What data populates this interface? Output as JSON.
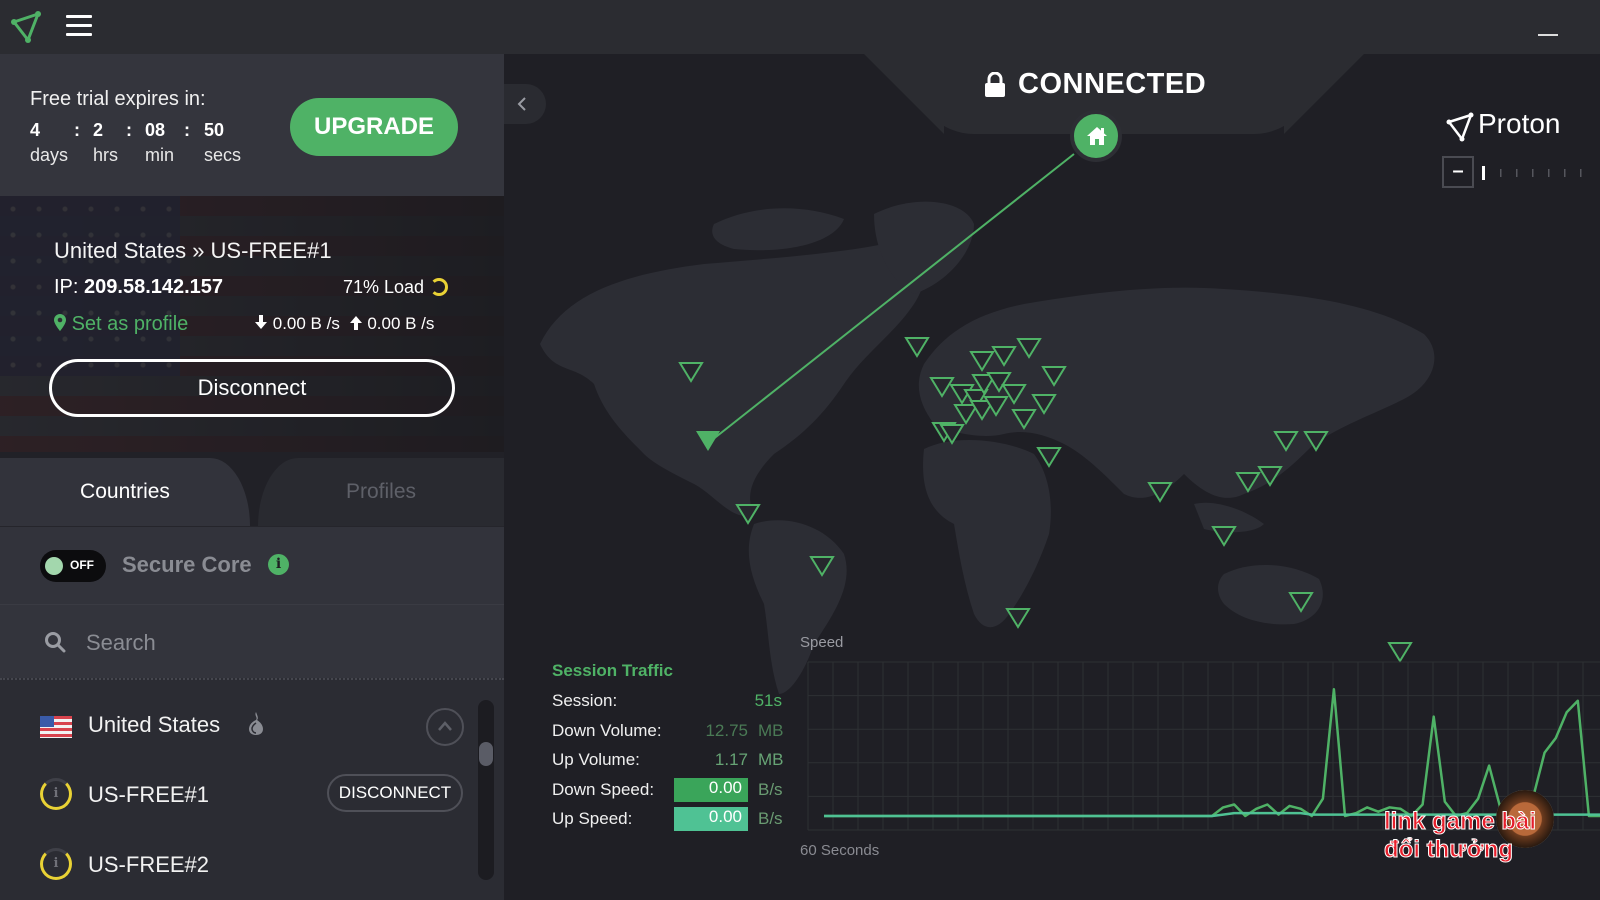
{
  "titlebar": {
    "logo_icon": "proton-triangle-logo",
    "menu_icon": "hamburger-menu-icon",
    "minimize_icon": "minimize-icon"
  },
  "trial": {
    "label": "Free trial expires in:",
    "countdown": [
      {
        "value": "4",
        "unit": "days"
      },
      {
        "value": "2",
        "unit": "hrs"
      },
      {
        "value": "08",
        "unit": "min"
      },
      {
        "value": "50",
        "unit": "secs"
      }
    ],
    "separator": ":",
    "upgrade_label": "UPGRADE"
  },
  "server": {
    "title": "United States » US-FREE#1",
    "ip_label": "IP:",
    "ip": "209.58.142.157",
    "load": "71% Load",
    "load_percent": 71,
    "set_profile_label": "Set as profile",
    "down_speed": "0.00 B /s",
    "up_speed": "0.00 B /s",
    "disconnect_label": "Disconnect"
  },
  "tabs": [
    {
      "label": "Countries",
      "active": true
    },
    {
      "label": "Profiles",
      "active": false
    }
  ],
  "secure_core": {
    "toggle_state": "OFF",
    "label": "Secure Core"
  },
  "search": {
    "placeholder": "Search",
    "value": ""
  },
  "country_list": {
    "country": "United States",
    "servers": [
      {
        "name": "US-FREE#1",
        "action": "DISCONNECT",
        "connected": true
      },
      {
        "name": "US-FREE#2",
        "action": "",
        "connected": false
      }
    ]
  },
  "map": {
    "status": "CONNECTED",
    "brand": "Proton",
    "zoom_out_label": "–",
    "accent": "#4fb266"
  },
  "session_traffic": {
    "title": "Session Traffic",
    "rows": [
      {
        "label": "Session:",
        "value": "51s",
        "unit": ""
      },
      {
        "label": "Down Volume:",
        "value": "12.75",
        "unit": "MB"
      },
      {
        "label": "Up Volume:",
        "value": "1.17",
        "unit": "MB"
      },
      {
        "label": "Down Speed:",
        "value": "0.00",
        "unit": "B/s"
      },
      {
        "label": "Up Speed:",
        "value": "0.00",
        "unit": "B/s"
      }
    ]
  },
  "chart_data": {
    "type": "line",
    "title": "Speed",
    "xlabel": "60 Seconds",
    "ylabel": "",
    "x_range": [
      0,
      60
    ],
    "ylim": [
      0,
      100
    ],
    "grid": true,
    "series": [
      {
        "name": "download",
        "color": "#4fb266",
        "values": [
          0,
          0,
          0,
          0,
          0,
          0,
          0,
          0,
          0,
          0,
          0,
          0,
          0,
          0,
          0,
          0,
          0,
          0,
          0,
          0,
          0,
          0,
          0,
          0,
          0,
          0,
          0,
          0,
          0,
          0,
          0,
          0,
          0,
          0,
          0,
          0,
          6,
          8,
          0,
          5,
          8,
          1,
          7,
          5,
          0,
          12,
          88,
          0,
          2,
          6,
          3,
          6,
          5,
          0,
          8,
          69,
          10,
          0,
          2,
          12,
          35,
          6,
          0,
          2,
          14,
          44,
          54,
          72,
          80,
          0,
          0
        ]
      },
      {
        "name": "upload",
        "color": "#4fc294",
        "values": [
          0,
          0,
          0,
          0,
          0,
          0,
          0,
          0,
          0,
          0,
          0,
          0,
          0,
          0,
          0,
          0,
          0,
          0,
          0,
          0,
          0,
          0,
          0,
          0,
          0,
          0,
          0,
          0,
          0,
          0,
          0,
          0,
          0,
          0,
          0,
          0,
          1,
          2,
          2,
          2,
          2,
          2,
          2,
          2,
          1,
          1,
          1,
          1,
          1,
          1,
          1,
          1,
          1,
          1,
          1,
          1,
          1,
          1,
          1,
          1,
          1,
          1,
          1,
          1,
          1,
          1,
          1,
          1,
          1,
          1,
          1
        ]
      }
    ]
  },
  "watermark": {
    "line1": "link game bài",
    "line2": "đổi thưởng"
  }
}
